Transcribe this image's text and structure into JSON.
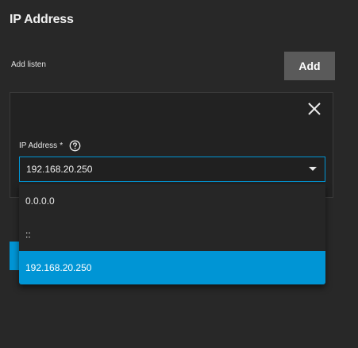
{
  "header": {
    "title": "IP Address"
  },
  "listen": {
    "label": "Add listen",
    "add_label": "Add"
  },
  "field": {
    "label": "IP Address",
    "required_marker": "*",
    "value": "192.168.20.250"
  },
  "dropdown": {
    "options": [
      {
        "label": "0.0.0.0",
        "selected": false
      },
      {
        "label": "::",
        "selected": false
      },
      {
        "label": "192.168.20.250",
        "selected": true
      }
    ]
  },
  "colors": {
    "accent": "#0095d5",
    "background": "#282828",
    "card": "#222222",
    "button": "#5a5a5a"
  },
  "icons": {
    "close": "close-icon",
    "help": "help-icon",
    "dropdown": "chevron-down-icon"
  }
}
